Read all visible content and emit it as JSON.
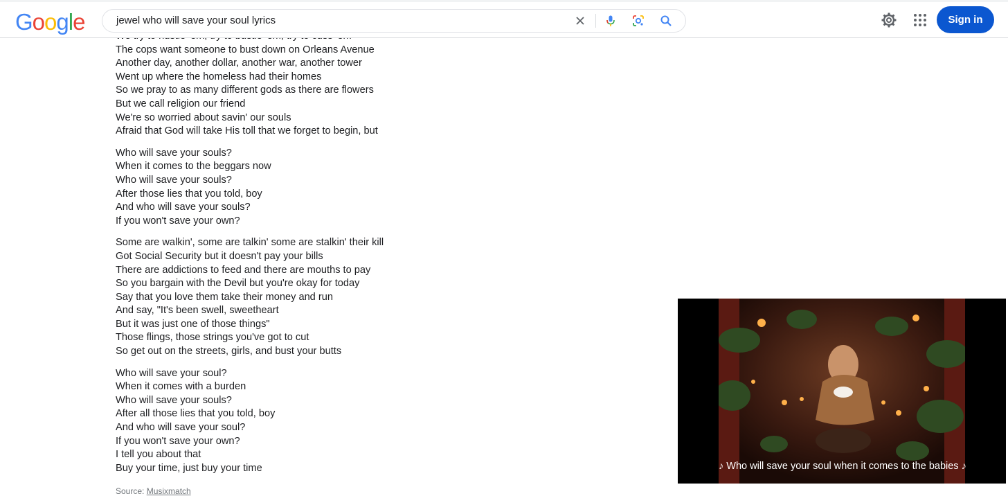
{
  "logo": {
    "letters": [
      {
        "ch": "G",
        "color": "#4285F4"
      },
      {
        "ch": "o",
        "color": "#EA4335"
      },
      {
        "ch": "o",
        "color": "#FBBC05"
      },
      {
        "ch": "g",
        "color": "#4285F4"
      },
      {
        "ch": "l",
        "color": "#34A853"
      },
      {
        "ch": "e",
        "color": "#EA4335"
      }
    ]
  },
  "search": {
    "query": "jewel who will save your soul lyrics",
    "icons": [
      "close-icon",
      "microphone-icon",
      "lens-icon",
      "search-icon"
    ]
  },
  "header": {
    "settings_icon": "gear-icon",
    "apps_icon": "apps-grid-icon",
    "signin_label": "Sign in",
    "accent": "#0b57d0"
  },
  "lyrics": {
    "stanzas": [
      {
        "lines": [
          "We try to hustle 'em, try to bustle 'em, try to cuss 'em",
          "The cops want someone to bust down on Orleans Avenue",
          "Another day, another dollar, another war, another tower",
          "Went up where the homeless had their homes",
          "So we pray to as many different gods as there are flowers",
          "But we call religion our friend",
          "We're so worried about savin' our souls",
          "Afraid that God will take His toll that we forget to begin, but"
        ]
      },
      {
        "lines": [
          "Who will save your souls?",
          "When it comes to the beggars now",
          "Who will save your souls?",
          "After those lies that you told, boy",
          "And who will save your souls?",
          "If you won't save your own?"
        ]
      },
      {
        "lines": [
          "Some are walkin', some are talkin' some are stalkin' their kill",
          "Got Social Security but it doesn't pay your bills",
          "There are addictions to feed and there are mouths to pay",
          "So you bargain with the Devil but you're okay for today",
          "Say that you love them take their money and run",
          "And say, \"It's been swell, sweetheart",
          "But it was just one of those things\"",
          "Those flings, those strings you've got to cut",
          "So get out on the streets, girls, and bust your butts"
        ]
      },
      {
        "lines": [
          "Who will save your soul?",
          "When it comes with a burden",
          "Who will save your souls?",
          "After all those lies that you told, boy",
          "And who will save your soul?",
          "If you won't save your own?",
          "I tell you about that",
          "Buy your time, just buy your time"
        ]
      }
    ],
    "source_label": "Source: ",
    "source_link": "Musixmatch"
  },
  "video": {
    "caption": "♪ Who will save your soul when it comes to the babies ♪"
  }
}
